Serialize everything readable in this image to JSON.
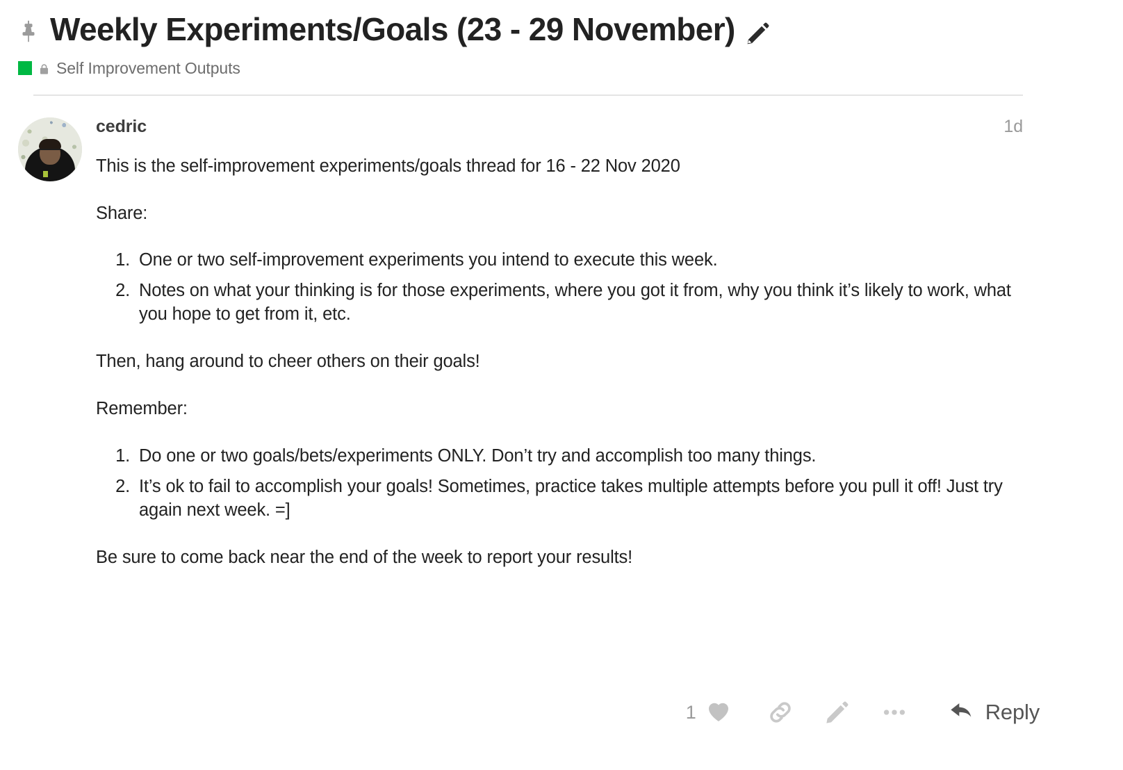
{
  "header": {
    "pin_icon": "pin-icon",
    "title": "Weekly Experiments/Goals (23 - 29 November)",
    "edit_icon": "pencil-icon",
    "category": {
      "color": "#00b843",
      "lock_icon": "lock-icon",
      "name": "Self Improvement Outputs"
    }
  },
  "post": {
    "avatar_alt": "cedric",
    "author": "cedric",
    "time": "1d",
    "paragraphs": {
      "intro": "This is the self-improvement experiments/goals thread for 16 - 22 Nov 2020",
      "share_heading": "Share:",
      "cheer": "Then, hang around to cheer others on their goals!",
      "remember_heading": "Remember:",
      "closing": "Be sure to come back near the end of the week to report your results!"
    },
    "share_list": [
      "One or two self-improvement experiments you intend to execute this week.",
      "Notes on what your thinking is for those experiments, where you got it from, why you think it’s likely to work, what you hope to get from it, etc."
    ],
    "remember_list": [
      "Do one or two goals/bets/experiments ONLY. Don’t try and accomplish too many things.",
      "It’s ok to fail to accomplish your goals! Sometimes, practice takes multiple attempts before you pull it off! Just try again next week. =]"
    ],
    "actions": {
      "like_count": "1",
      "like_icon": "heart-icon",
      "link_icon": "link-icon",
      "edit_icon": "pencil-icon",
      "more_icon": "ellipsis-icon",
      "reply_icon": "reply-arrow-icon",
      "reply_label": "Reply"
    }
  },
  "colors": {
    "text": "#222222",
    "muted": "#9a9a9a",
    "category_green": "#00b843",
    "divider": "#e4e4e4"
  }
}
